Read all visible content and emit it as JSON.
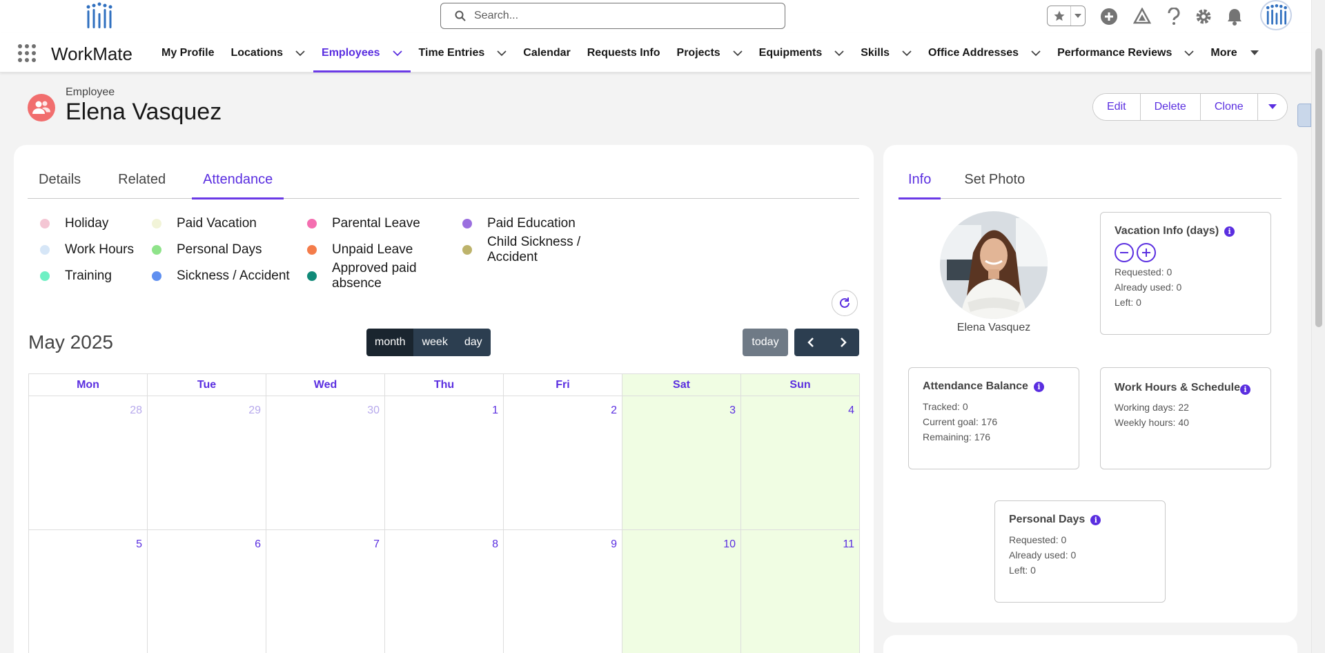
{
  "header": {
    "search_placeholder": "Search...",
    "icons": [
      "favorites-star-icon",
      "add-icon",
      "trailhead-icon",
      "help-icon",
      "setup-gear-icon",
      "notifications-bell-icon"
    ]
  },
  "nav": {
    "app_name": "WorkMate",
    "items": [
      {
        "label": "My Profile",
        "dropdown": false
      },
      {
        "label": "Locations",
        "dropdown": true
      },
      {
        "label": "Employees",
        "dropdown": true,
        "active": true
      },
      {
        "label": "Time Entries",
        "dropdown": true
      },
      {
        "label": "Calendar",
        "dropdown": false
      },
      {
        "label": "Requests Info",
        "dropdown": false
      },
      {
        "label": "Projects",
        "dropdown": true
      },
      {
        "label": "Equipments",
        "dropdown": true
      },
      {
        "label": "Skills",
        "dropdown": true
      },
      {
        "label": "Office Addresses",
        "dropdown": true
      },
      {
        "label": "Performance Reviews",
        "dropdown": true
      },
      {
        "label": "More",
        "dropdown": true
      }
    ]
  },
  "record": {
    "type": "Employee",
    "name": "Elena Vasquez",
    "actions": {
      "edit": "Edit",
      "delete": "Delete",
      "clone": "Clone"
    }
  },
  "tabs": [
    "Details",
    "Related",
    "Attendance"
  ],
  "legend": [
    {
      "label": "Holiday",
      "color": "#f4c6d4"
    },
    {
      "label": "Paid Vacation",
      "color": "#f2f4d8"
    },
    {
      "label": "Parental Leave",
      "color": "#f46eb0"
    },
    {
      "label": "Paid Education",
      "color": "#9b6fdf"
    },
    {
      "label": "Work Hours",
      "color": "#d6e6f7"
    },
    {
      "label": "Personal Days",
      "color": "#8fe38a"
    },
    {
      "label": "Unpaid Leave",
      "color": "#f47c4a"
    },
    {
      "label": "Child Sickness / Accident",
      "color": "#bdb36b"
    },
    {
      "label": "Training",
      "color": "#6ff0c4"
    },
    {
      "label": "Sickness / Accident",
      "color": "#5f8ff0"
    },
    {
      "label": "Approved paid absence",
      "color": "#108a78"
    }
  ],
  "calendar": {
    "title": "May 2025",
    "views": {
      "month": "month",
      "week": "week",
      "day": "day"
    },
    "today": "today",
    "weekdays": [
      "Mon",
      "Tue",
      "Wed",
      "Thu",
      "Fri",
      "Sat",
      "Sun"
    ],
    "weeks": [
      [
        "28",
        "29",
        "30",
        "1",
        "2",
        "3",
        "4"
      ],
      [
        "5",
        "6",
        "7",
        "8",
        "9",
        "10",
        "11"
      ]
    ]
  },
  "right": {
    "tabs": [
      "Info",
      "Set Photo"
    ],
    "photo_name": "Elena Vasquez",
    "vacation": {
      "title": "Vacation Info (days)",
      "requested": "Requested: 0",
      "used": "Already used: 0",
      "left": "Left: 0"
    },
    "attendance": {
      "title": "Attendance Balance",
      "tracked": "Tracked: 0",
      "goal": "Current goal: 176",
      "remaining": "Remaining: 176"
    },
    "workhours": {
      "title": "Work Hours & Schedule",
      "days": "Working days: 22",
      "weekly": "Weekly hours: 40"
    },
    "personal": {
      "title": "Personal Days",
      "requested": "Requested: 0",
      "used": "Already used: 0",
      "left": "Left: 0"
    }
  },
  "colors": {
    "accent": "#5a2ee0",
    "weekend": "#f0fde3",
    "record_icon": "#f16e6e"
  }
}
